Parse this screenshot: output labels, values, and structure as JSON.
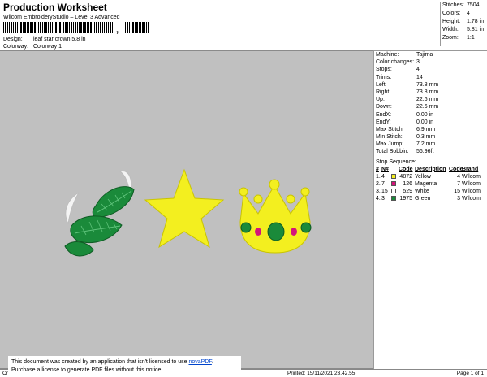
{
  "header": {
    "title": "Production Worksheet",
    "subtitle": "Wilcom EmbroideryStudio – Level 3 Advanced",
    "barcode_suffix": ",",
    "design_label": "Design:",
    "design_value": "leaf star crown 5,8 in",
    "colorway_label": "Colorway:",
    "colorway_value": "Colorway 1"
  },
  "top_stats": [
    {
      "label": "Stitches:",
      "value": "7504"
    },
    {
      "label": "Colors:",
      "value": "4"
    },
    {
      "label": "Height:",
      "value": "1.78 in"
    },
    {
      "label": "Width:",
      "value": "5.81 in"
    },
    {
      "label": "Zoom:",
      "value": "1:1"
    }
  ],
  "machine_info": [
    {
      "label": "Machine:",
      "value": "Tajima"
    },
    {
      "label": "Color changes:",
      "value": "3"
    },
    {
      "label": "Stops:",
      "value": "4"
    },
    {
      "label": "Trims:",
      "value": "14"
    },
    {
      "label": "Left:",
      "value": "73.8 mm"
    },
    {
      "label": "Right:",
      "value": "73.8 mm"
    },
    {
      "label": "Up:",
      "value": "22.6 mm"
    },
    {
      "label": "Down:",
      "value": "22.6 mm"
    },
    {
      "label": "EndX:",
      "value": "0.00 in"
    },
    {
      "label": "EndY:",
      "value": "0.00 in"
    },
    {
      "label": "Max Stitch:",
      "value": "6.9 mm"
    },
    {
      "label": "Min Stitch:",
      "value": "0.3 mm"
    },
    {
      "label": "Max Jump:",
      "value": "7.2 mm"
    },
    {
      "label": "Total Bobbin:",
      "value": "56.96ft"
    }
  ],
  "stop_sequence": {
    "heading": "Stop Sequence:",
    "columns": {
      "num": "#",
      "n": "N#",
      "code": "Code",
      "desc": "Description",
      "code2": "Code",
      "brand": "Brand"
    },
    "rows": [
      {
        "num": "1.",
        "n": "4",
        "code": "4872",
        "desc": "Yellow",
        "code2": "4",
        "brand": "Wilcom",
        "color": "#f3ef1f"
      },
      {
        "num": "2.",
        "n": "7",
        "code": "126",
        "desc": "Magenta",
        "code2": "7",
        "brand": "Wilcom",
        "color": "#d4147a"
      },
      {
        "num": "3.",
        "n": "15",
        "code": "529",
        "desc": "White",
        "code2": "15",
        "brand": "Wilcom",
        "color": "#ffffff"
      },
      {
        "num": "4.",
        "n": "3",
        "code": "1975",
        "desc": "Green",
        "code2": "3",
        "brand": "Wilcom",
        "color": "#1a8a3a"
      }
    ]
  },
  "notice": {
    "line1_prefix": "This document was created by an application that isn't licensed to use ",
    "link": "novaPDF",
    "line1_suffix": ".",
    "line2": "Purchase a license to generate PDF files without this notice."
  },
  "footer": {
    "left": "Cr",
    "printed": "Printed: 15/11/2021 23.42.55",
    "page": "Page 1 of 1"
  },
  "colors": {
    "canvas": "#c0c0c0",
    "leaf_green": "#1a8a3a",
    "star_yellow": "#f3ef1f",
    "gem_magenta": "#d4147a"
  }
}
